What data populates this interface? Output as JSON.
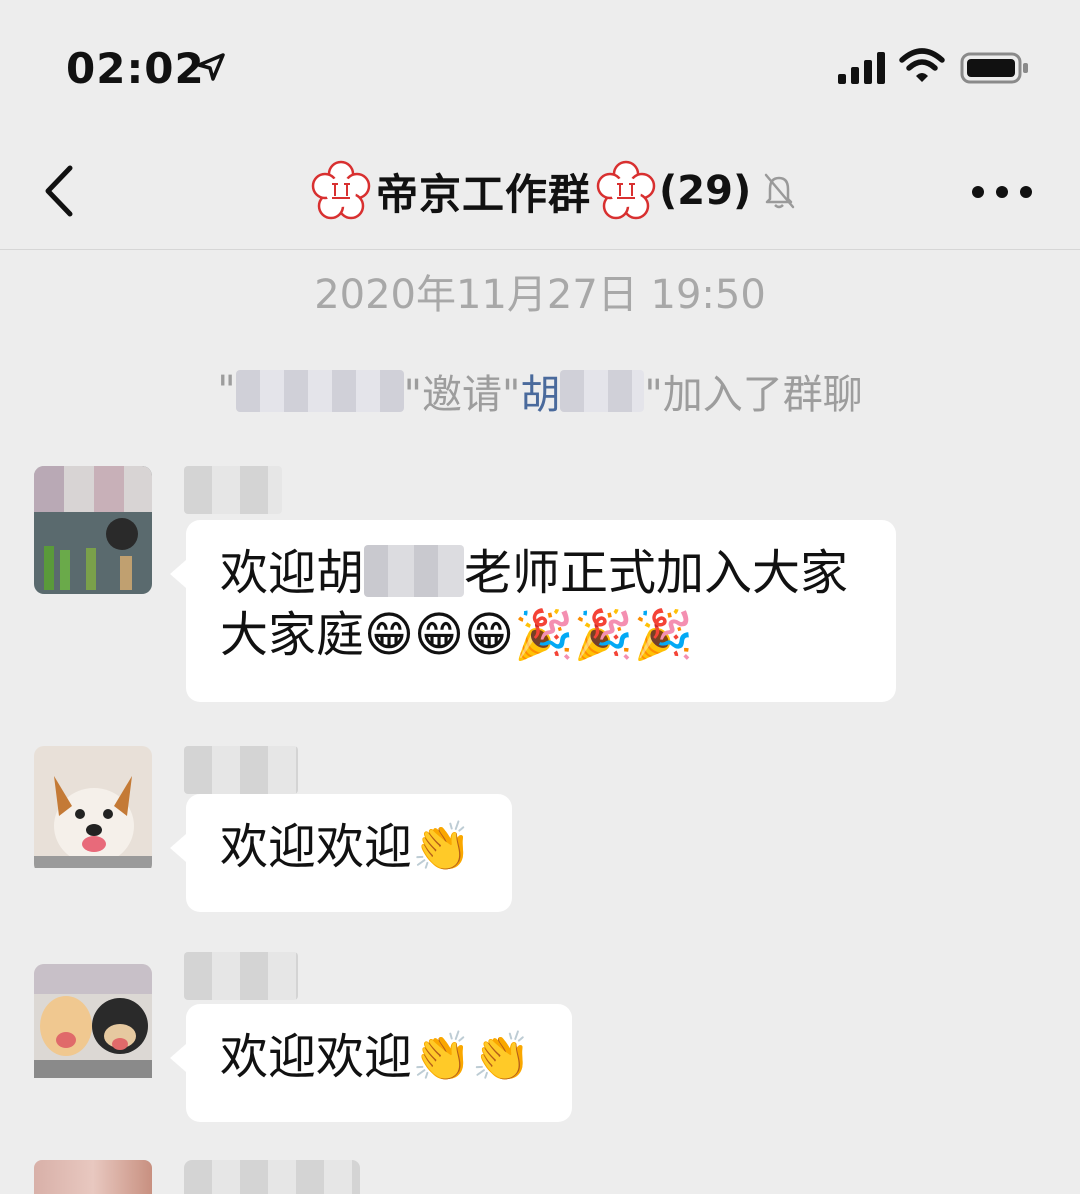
{
  "status_bar": {
    "time": "02:02",
    "icons": [
      "location-arrow-icon",
      "cellular-signal-icon",
      "wifi-icon",
      "battery-icon"
    ]
  },
  "nav": {
    "back_icon": "chevron-left-icon",
    "title": "帝京工作群",
    "member_count": "(29)",
    "mute_icon": "bell-muted-icon",
    "more_icon": "ellipsis-icon"
  },
  "timestamp": "2020年11月27日 19:50",
  "system_message": {
    "quote_open": "\"",
    "inviter_prefix": "",
    "invite_text": "\"邀请\"",
    "invitee": "胡",
    "suffix": "\"加入了群聊"
  },
  "messages": [
    {
      "text_before": "欢迎胡",
      "text_after": "老师正式加入大家大家庭",
      "emoji": "😁😁😁🎉🎉🎉"
    },
    {
      "text_before": "欢迎欢迎",
      "text_after": "",
      "emoji": "👏"
    },
    {
      "text_before": "欢迎欢迎",
      "text_after": "",
      "emoji": "👏👏"
    }
  ],
  "colors": {
    "background": "#ededed",
    "bubble": "#ffffff",
    "link": "#4a6a9c",
    "muted_text": "#a8a8a8"
  }
}
